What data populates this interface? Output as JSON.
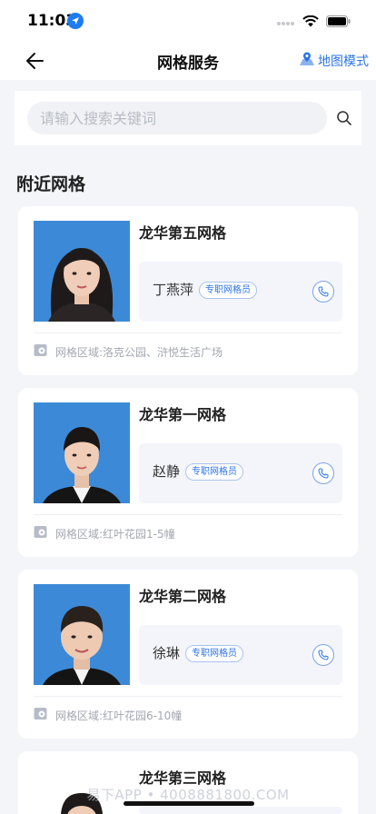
{
  "status_bar": {
    "time": "11:03"
  },
  "nav": {
    "title": "网格服务",
    "map_mode": "地图模式"
  },
  "search": {
    "placeholder": "请输入搜索关键词"
  },
  "section_title": "附近网格",
  "cards": [
    {
      "grid_name": "龙华第五网格",
      "staff_name": "丁燕萍",
      "role": "专职网格员",
      "area": "网格区域:洛克公园、浒悦生活广场"
    },
    {
      "grid_name": "龙华第一网格",
      "staff_name": "赵静",
      "role": "专职网格员",
      "area": "网格区域:红叶花园1-5幢"
    },
    {
      "grid_name": "龙华第二网格",
      "staff_name": "徐琳",
      "role": "专职网格员",
      "area": "网格区域:红叶花园6-10幢"
    },
    {
      "grid_name": "龙华第三网格"
    }
  ],
  "watermark": "易下APP • 4008881800.COM",
  "colors": {
    "accent": "#2c74e8",
    "photo_bg": "#3c8ad7",
    "page_bg": "#f3f5f9"
  }
}
